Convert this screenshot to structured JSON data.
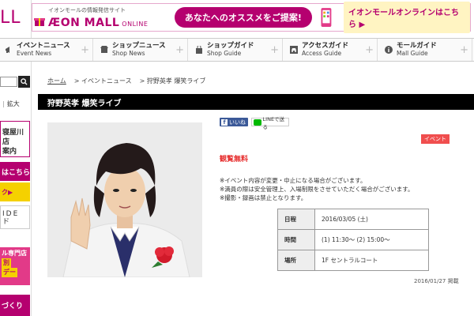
{
  "sidebar": {
    "logo_fragment": "LL",
    "fontsize_label_sep": "|",
    "fontsize_enlarge": "拡大",
    "store_name": "寝屋川店\n案内",
    "here_button": "はこちら",
    "yellow_label": "ク▶",
    "ride_label": "IDE\nド",
    "pink_line1": "ル専門店",
    "pink_line2": "別",
    "pink_line3": "デー",
    "bottom_label": "づくり"
  },
  "banner": {
    "sub_text": "イオンモールの情報発信サイト",
    "brand": "ÆON MALL",
    "brand_suffix": "ONLINE",
    "pill_text": "あなたへのオススメをご提案!",
    "cta_text": "イオンモールオンラインはこちら ▶"
  },
  "nav": {
    "items": [
      {
        "jp": "イベントニュース",
        "en": "Event News",
        "plus": "+"
      },
      {
        "jp": "ショップニュース",
        "en": "Shop News",
        "plus": "+"
      },
      {
        "jp": "ショップガイド",
        "en": "Shop Guide",
        "plus": "+"
      },
      {
        "jp": "アクセスガイド",
        "en": "Access Guide",
        "plus": "+"
      },
      {
        "jp": "モールガイド",
        "en": "Mall Guide",
        "plus": "+"
      }
    ]
  },
  "breadcrumb": {
    "home": "ホーム",
    "crumb2": "> イベントニュース",
    "crumb3": "> 狩野英孝 爆笑ライブ"
  },
  "page": {
    "title": "狩野英孝 爆笑ライブ",
    "fb_label": "いいね",
    "line_label": "LINEで送る",
    "badge": "イベント",
    "free": "観覧無料",
    "note1": "※イベント内容が変更・中止になる場合がございます。",
    "note2": "※満員の際は安全管理上、入場制限をさせていただく場合がございます。",
    "note3": "※撮影・録画は禁止となります。",
    "table": [
      {
        "label": "日程",
        "value": "2016/03/05 (土)"
      },
      {
        "label": "時間",
        "value": "(1) 11:30〜 (2) 15:00〜"
      },
      {
        "label": "場所",
        "value": "1F セントラルコート"
      }
    ],
    "posted": "2016/01/27 掲載"
  },
  "colors": {
    "brand": "#b5006f",
    "accent_red": "#e62b2b",
    "badge_red": "#f04e4e",
    "title_bar": "#000000"
  }
}
